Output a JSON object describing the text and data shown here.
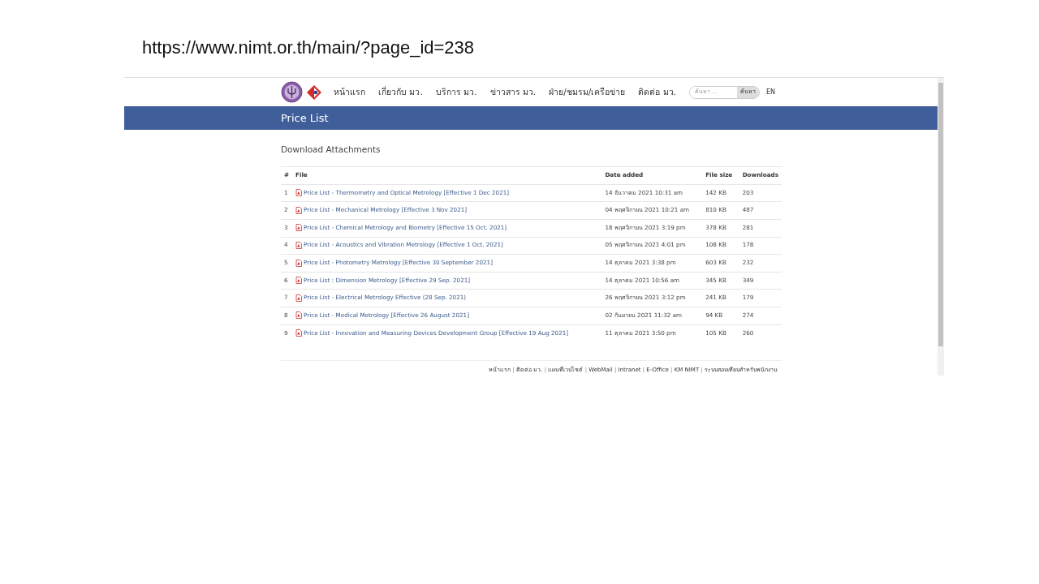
{
  "slide_caption": "https://www.nimt.or.th/main/?page_id=238",
  "nav": [
    {
      "label": "หน้าแรก"
    },
    {
      "label": "เกี่ยวกับ มว."
    },
    {
      "label": "บริการ มว."
    },
    {
      "label": "ข่าวสาร มว."
    },
    {
      "label": "ฝ่าย/ชมรม/เครือข่าย"
    },
    {
      "label": "ติดต่อ มว."
    }
  ],
  "search": {
    "placeholder": "ค้นหา ...",
    "button": "ค้นหา"
  },
  "language": "EN",
  "page_title": "Price List",
  "section_title": "Download Attachments",
  "table": {
    "columns": [
      "#",
      "File",
      "Date added",
      "File size",
      "Downloads"
    ],
    "rows": [
      {
        "num": "1",
        "file": "Price List - Thermometry and Optical Metrology [Effective 1 Dec 2021]",
        "date": "14 ธันวาคม 2021 10:31 am",
        "size": "142 KB",
        "downloads": "203"
      },
      {
        "num": "2",
        "file": "Price List - Mechanical Metrology [Effective 3 Nov 2021]",
        "date": "04 พฤศจิกายน 2021 10:21 am",
        "size": "810 KB",
        "downloads": "487"
      },
      {
        "num": "3",
        "file": "Price List - Chemical Metrology and Biometry [Effective 15 Oct. 2021]",
        "date": "18 พฤศจิกายน 2021 3:19 pm",
        "size": "378 KB",
        "downloads": "281"
      },
      {
        "num": "4",
        "file": "Price List - Acoustics and Vibration Metrology [Effective 1 Oct. 2021]",
        "date": "05 พฤศจิกายน 2021 4:01 pm",
        "size": "108 KB",
        "downloads": "178"
      },
      {
        "num": "5",
        "file": "Price List - Photometry Metrology [Effective 30 September 2021]",
        "date": "14 ตุลาคม 2021 3:38 pm",
        "size": "603 KB",
        "downloads": "232"
      },
      {
        "num": "6",
        "file": "Price List : Dimension Metrology [Effective 29 Sep. 2021]",
        "date": "14 ตุลาคม 2021 10:56 am",
        "size": "345 KB",
        "downloads": "349"
      },
      {
        "num": "7",
        "file": "Price List - Electrical Metrology Effective (28 Sep. 2021)",
        "date": "26 พฤศจิกายน 2021 3:12 pm",
        "size": "241 KB",
        "downloads": "179"
      },
      {
        "num": "8",
        "file": "Price List - Medical Metrology [Effective 26 August 2021]",
        "date": "02 กันยายน 2021 11:32 am",
        "size": "94 KB",
        "downloads": "274"
      },
      {
        "num": "9",
        "file": "Price List - Innovation and Measuring Devices Development Group [Effective 19 Aug 2021]",
        "date": "11 ตุลาคม 2021 3:50 pm",
        "size": "105 KB",
        "downloads": "260"
      }
    ]
  },
  "footer": [
    {
      "kind": "link",
      "text": "หน้าแรก"
    },
    {
      "kind": "separator",
      "text": "|"
    },
    {
      "kind": "link",
      "text": "ติดต่อ มว."
    },
    {
      "kind": "separator",
      "text": "|"
    },
    {
      "kind": "link",
      "text": "แผนที่เวปไซต์"
    },
    {
      "kind": "separator",
      "text": "|"
    },
    {
      "kind": "link",
      "text": "WebMail"
    },
    {
      "kind": "separator",
      "text": "|"
    },
    {
      "kind": "link",
      "text": "Intranet"
    },
    {
      "kind": "separator",
      "text": "|"
    },
    {
      "kind": "link",
      "text": "E-Office"
    },
    {
      "kind": "separator",
      "text": "|"
    },
    {
      "kind": "link",
      "text": "KM NIMT"
    },
    {
      "kind": "separator",
      "text": "|"
    },
    {
      "kind": "link",
      "text": "ระบบสอบเทียบสำหรับพนักงาน"
    }
  ]
}
